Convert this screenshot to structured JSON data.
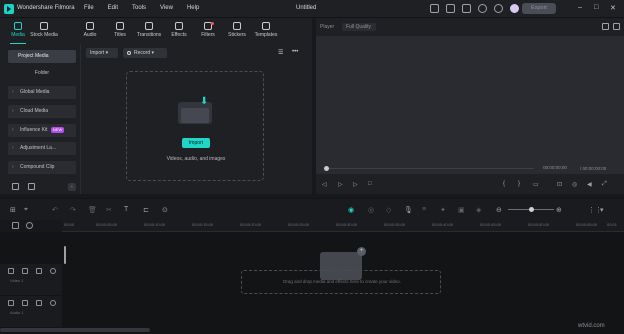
{
  "app": {
    "name": "Wondershare Filmora",
    "title": "Untitled",
    "export_label": "Export"
  },
  "menu": [
    "File",
    "Edit",
    "Tools",
    "View",
    "Help"
  ],
  "media_tabs": [
    {
      "label": "Media",
      "active": true
    },
    {
      "label": "Stock Media"
    },
    {
      "label": "Audio"
    },
    {
      "label": "Titles"
    },
    {
      "label": "Transitions"
    },
    {
      "label": "Effects"
    },
    {
      "label": "Filters"
    },
    {
      "label": "Stickers"
    },
    {
      "label": "Templates"
    }
  ],
  "sidebar": {
    "items": [
      {
        "label": "Project Media",
        "active": true
      },
      {
        "label": "Folder"
      },
      {
        "label": "Global Media"
      },
      {
        "label": "Cloud Media"
      },
      {
        "label": "Influence Kit",
        "badge": "NEW"
      },
      {
        "label": "Adjustment La..."
      },
      {
        "label": "Compound Clip"
      }
    ]
  },
  "media_toolbar": {
    "import_label": "Import",
    "record_label": "Record"
  },
  "dropzone": {
    "button": "Import",
    "caption": "Videos, audio, and images"
  },
  "player": {
    "label": "Player",
    "quality": "Full Quality",
    "current_time": "00:00:00:00",
    "total_time": "00:00:00:00"
  },
  "timeline": {
    "ruler": [
      "00:00",
      "00:00:05:00",
      "00:00:10:00",
      "00:00:15:00",
      "00:00:20:00",
      "00:00:25:00",
      "00:00:30:00",
      "00:00:35:00",
      "00:00:40:00",
      "00:00:45:00",
      "00:00:50:00",
      "00:00:55:00",
      "00:01"
    ],
    "track_labels": [
      "Video 1",
      "Audio 1"
    ],
    "drop_text": "Drag and drop media and effects here to create your video."
  },
  "watermark": "wtvid.com"
}
